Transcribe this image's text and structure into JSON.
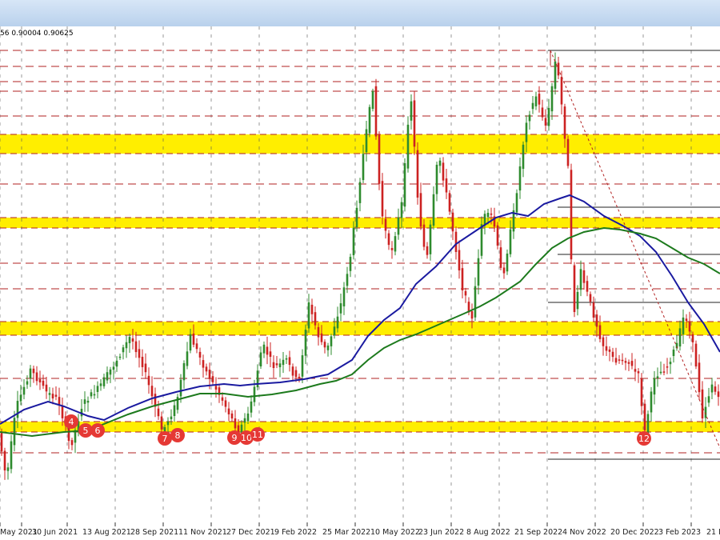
{
  "window": {
    "ohlc_text": "56 0.90004 0.90625"
  },
  "colors": {
    "background": "#ffffff",
    "title_bar": "#c6daf1",
    "bull_candle": "#2e8b2e",
    "bear_candle": "#cc2222",
    "ma_blue": "#1a1aa0",
    "ma_green": "#1d7a1d",
    "support_zone": "#ffee00",
    "dashed_level": "#b22222",
    "marker": "#e53935"
  },
  "chart_data": {
    "type": "candlestick",
    "x_ticks": [
      "May 2021",
      "30 Jun 2021",
      "13 Aug 2021",
      "28 Sep 2021",
      "11 Nov 2021",
      "27 Dec 2021",
      "9 Feb 2022",
      "25 Mar 2022",
      "10 May 2022",
      "23 Jun 2022",
      "8 Aug 2022",
      "21 Sep 2022",
      "4 Nov 2022",
      "20 Dec 2022",
      "3 Feb 2023",
      "21 M"
    ],
    "highlight_zones": [
      "zone-1",
      "zone-2",
      "zone-3",
      "zone-4"
    ],
    "dashed_levels": 11,
    "trend_lines": [
      "diagonal-trendline"
    ],
    "moving_averages": [
      {
        "name": "100-bar MA",
        "color": "#1a1aa0"
      },
      {
        "name": "200-bar MA",
        "color": "#1d7a1d"
      }
    ],
    "swing_markers": [
      "4",
      "5",
      "6",
      "7",
      "8",
      "9",
      "10",
      "11",
      "12"
    ]
  }
}
